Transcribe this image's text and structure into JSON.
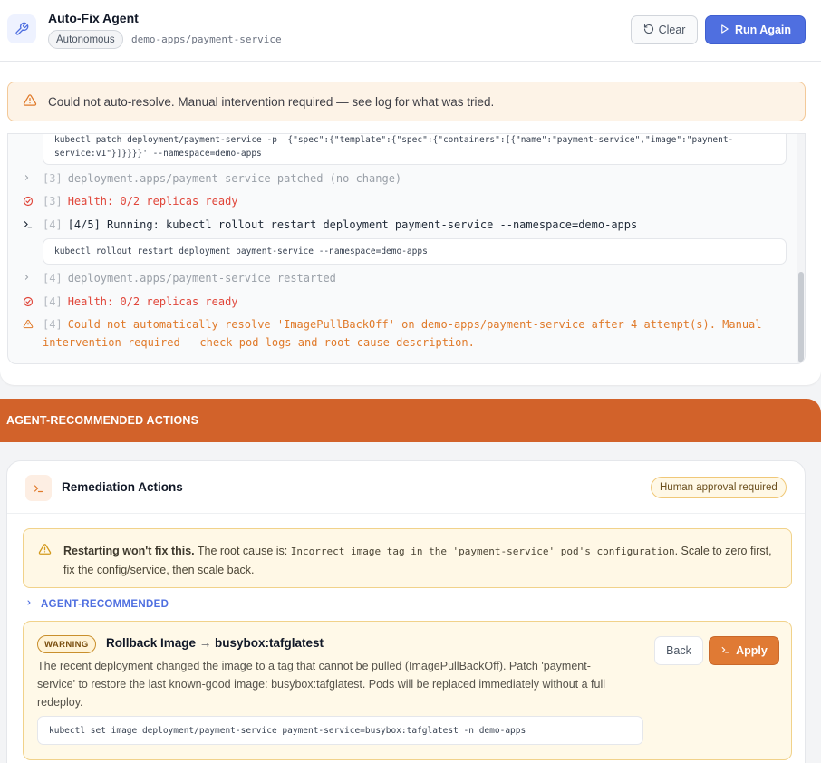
{
  "header": {
    "title": "Auto-Fix Agent",
    "mode": "Autonomous",
    "target": "demo-apps/payment-service",
    "clear_label": "Clear",
    "run_label": "Run Again"
  },
  "alert": {
    "text": "Could not auto-resolve. Manual intervention required — see log for what was tried."
  },
  "log": {
    "cmd_patch_line1": "kubectl patch deployment/payment-service -p '{\"spec\":{\"template\":{\"spec\":{\"containers\":[{\"name\":\"payment-service\",\"image\":\"payment-",
    "cmd_patch_line2": "service:v1\"}]}}}}' --namespace=demo-apps",
    "entries": [
      {
        "num": "[3]",
        "text": "deployment.apps/payment-service patched (no change)"
      },
      {
        "num": "[3]",
        "text": "Health: 0/2 replicas ready"
      },
      {
        "num": "[4]",
        "text": "[4/5] Running: kubectl rollout restart deployment payment-service --namespace=demo-apps"
      },
      {
        "num": "[4]",
        "text": "deployment.apps/payment-service restarted"
      },
      {
        "num": "[4]",
        "text": "Health: 0/2 replicas ready"
      },
      {
        "num": "[4]",
        "text": "Could not automatically resolve 'ImagePullBackOff' on demo-apps/payment-service after 4 attempt(s). Manual",
        "text2": "intervention required — check pod logs and root cause description."
      }
    ],
    "cmd_restart": "kubectl rollout restart deployment payment-service --namespace=demo-apps"
  },
  "section": {
    "title": "AGENT-RECOMMENDED ACTIONS"
  },
  "remediation": {
    "title": "Remediation Actions",
    "approval": "Human approval required",
    "warning_bold": "Restarting won't fix this.",
    "warning_pre": "The root cause is:",
    "warning_code": "Incorrect image tag in the 'payment-service' pod's configuration",
    "warning_post": ". Scale to zero first,",
    "warning_line2": "fix the config/service, then scale back.",
    "agent_recommended": "AGENT-RECOMMENDED",
    "action": {
      "badge": "WARNING",
      "title": "Rollback Image → busybox:tafglatest",
      "desc": "The recent deployment changed the image to a tag that cannot be pulled (ImagePullBackOff). Patch 'payment-service' to restore the last known-good image: busybox:tafglatest. Pods will be replaced immediately without a full redeploy.",
      "command": "kubectl set image deployment/payment-service payment-service=busybox:tafglatest -n demo-apps",
      "back_label": "Back",
      "apply_label": "Apply"
    }
  },
  "colors": {
    "accent": "#4f6fe0",
    "section_bar": "#d2622a",
    "error": "#e0463a",
    "warning": "#e07a2a"
  }
}
